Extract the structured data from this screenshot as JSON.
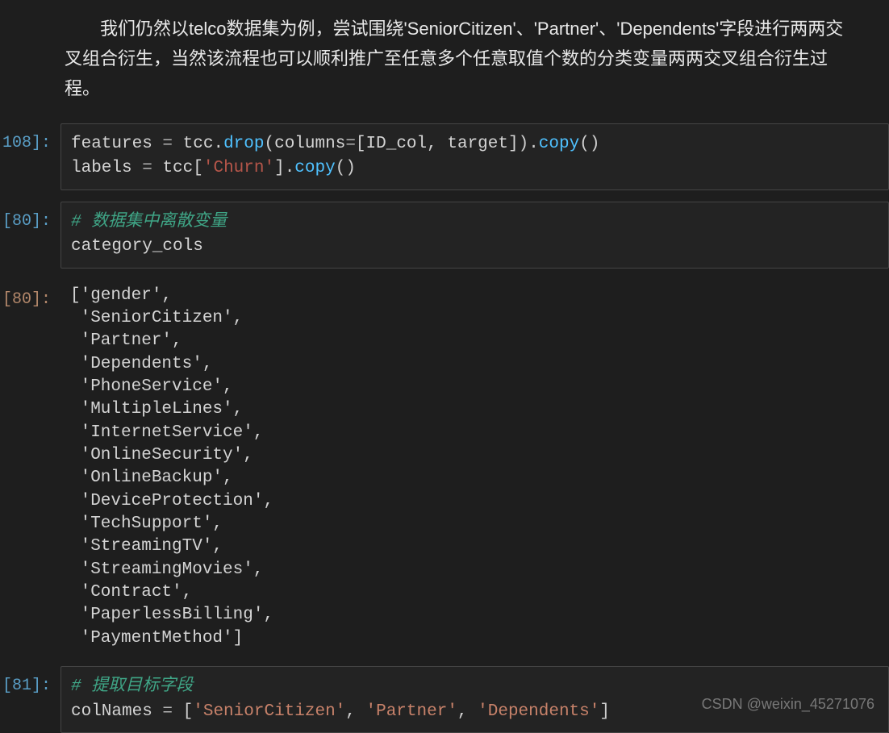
{
  "markdown": {
    "text": "我们仍然以telco数据集为例，尝试围绕'SeniorCitizen'、'Partner'、'Dependents'字段进行两两交叉组合衍生，当然该流程也可以顺利推广至任意多个任意取值个数的分类变量两两交叉组合衍生过程。"
  },
  "cells": [
    {
      "prompt": "108]:",
      "type": "input",
      "segments": [
        [
          {
            "t": "features ",
            "c": "tok-var"
          },
          {
            "t": "= ",
            "c": "tok-op"
          },
          {
            "t": "tcc",
            "c": "tok-var"
          },
          {
            "t": ".",
            "c": "tok-punc"
          },
          {
            "t": "drop",
            "c": "tok-fn"
          },
          {
            "t": "(",
            "c": "tok-punc"
          },
          {
            "t": "columns",
            "c": "tok-var"
          },
          {
            "t": "=",
            "c": "tok-op"
          },
          {
            "t": "[ID_col",
            "c": "tok-var"
          },
          {
            "t": ", ",
            "c": "tok-punc"
          },
          {
            "t": "target]",
            "c": "tok-var"
          },
          {
            "t": ")",
            "c": "tok-punc"
          },
          {
            "t": ".",
            "c": "tok-punc"
          },
          {
            "t": "copy",
            "c": "tok-fn"
          },
          {
            "t": "()",
            "c": "tok-punc"
          }
        ],
        [
          {
            "t": "labels ",
            "c": "tok-var"
          },
          {
            "t": "= ",
            "c": "tok-op"
          },
          {
            "t": "tcc[",
            "c": "tok-var"
          },
          {
            "t": "'Churn'",
            "c": "tok-str-red"
          },
          {
            "t": "]",
            "c": "tok-var"
          },
          {
            "t": ".",
            "c": "tok-punc"
          },
          {
            "t": "copy",
            "c": "tok-fn"
          },
          {
            "t": "()",
            "c": "tok-punc"
          }
        ]
      ]
    },
    {
      "prompt": "[80]:",
      "type": "input",
      "segments": [
        [
          {
            "t": "# 数据集中离散变量",
            "c": "tok-comment"
          }
        ],
        [
          {
            "t": "category_cols",
            "c": "tok-var"
          }
        ]
      ]
    },
    {
      "prompt": "[80]:",
      "type": "output",
      "text": "['gender',\n 'SeniorCitizen',\n 'Partner',\n 'Dependents',\n 'PhoneService',\n 'MultipleLines',\n 'InternetService',\n 'OnlineSecurity',\n 'OnlineBackup',\n 'DeviceProtection',\n 'TechSupport',\n 'StreamingTV',\n 'StreamingMovies',\n 'Contract',\n 'PaperlessBilling',\n 'PaymentMethod']"
    },
    {
      "prompt": "[81]:",
      "type": "input",
      "segments": [
        [
          {
            "t": "# 提取目标字段",
            "c": "tok-comment"
          }
        ],
        [
          {
            "t": "colNames ",
            "c": "tok-var"
          },
          {
            "t": "= ",
            "c": "tok-op"
          },
          {
            "t": "[",
            "c": "tok-punc"
          },
          {
            "t": "'SeniorCitizen'",
            "c": "tok-str"
          },
          {
            "t": ", ",
            "c": "tok-punc"
          },
          {
            "t": "'Partner'",
            "c": "tok-str"
          },
          {
            "t": ", ",
            "c": "tok-punc"
          },
          {
            "t": "'Dependents'",
            "c": "tok-str"
          },
          {
            "t": "]",
            "c": "tok-punc"
          }
        ]
      ]
    }
  ],
  "watermark": "CSDN @weixin_45271076"
}
